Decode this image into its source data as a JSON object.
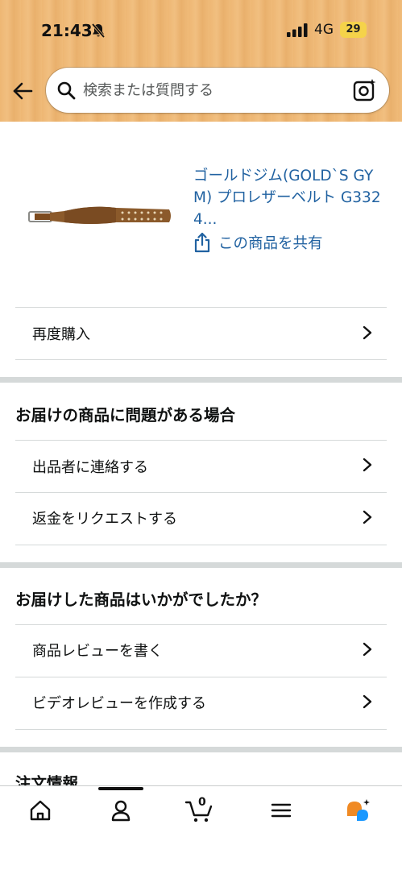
{
  "status": {
    "time": "21:43",
    "network": "4G",
    "battery": "29"
  },
  "search": {
    "placeholder": "検索または質問する"
  },
  "product": {
    "title": "ゴールドジム(GOLD`S GYM) プロレザーベルト G3324...",
    "share_label": "この商品を共有"
  },
  "rows": {
    "buy_again": "再度購入"
  },
  "problem_section": {
    "heading": "お届けの商品に問題がある場合",
    "items": [
      "出品者に連絡する",
      "返金をリクエストする"
    ]
  },
  "review_section": {
    "heading": "お届けした商品はいかがでしたか？",
    "items": [
      "商品レビューを書く",
      "ビデオレビューを作成する"
    ]
  },
  "order_info": {
    "heading": "注文情報"
  },
  "bottom_nav": {
    "cart_count": "0",
    "items": [
      "home-icon",
      "account-icon",
      "cart-icon",
      "menu-icon",
      "rufus-icon"
    ]
  },
  "colors": {
    "header_bg": "#eeb774",
    "link": "#2162a1",
    "battery": "#f5d34a",
    "rufus_orange": "#f08a24",
    "rufus_blue": "#1a98ff"
  }
}
